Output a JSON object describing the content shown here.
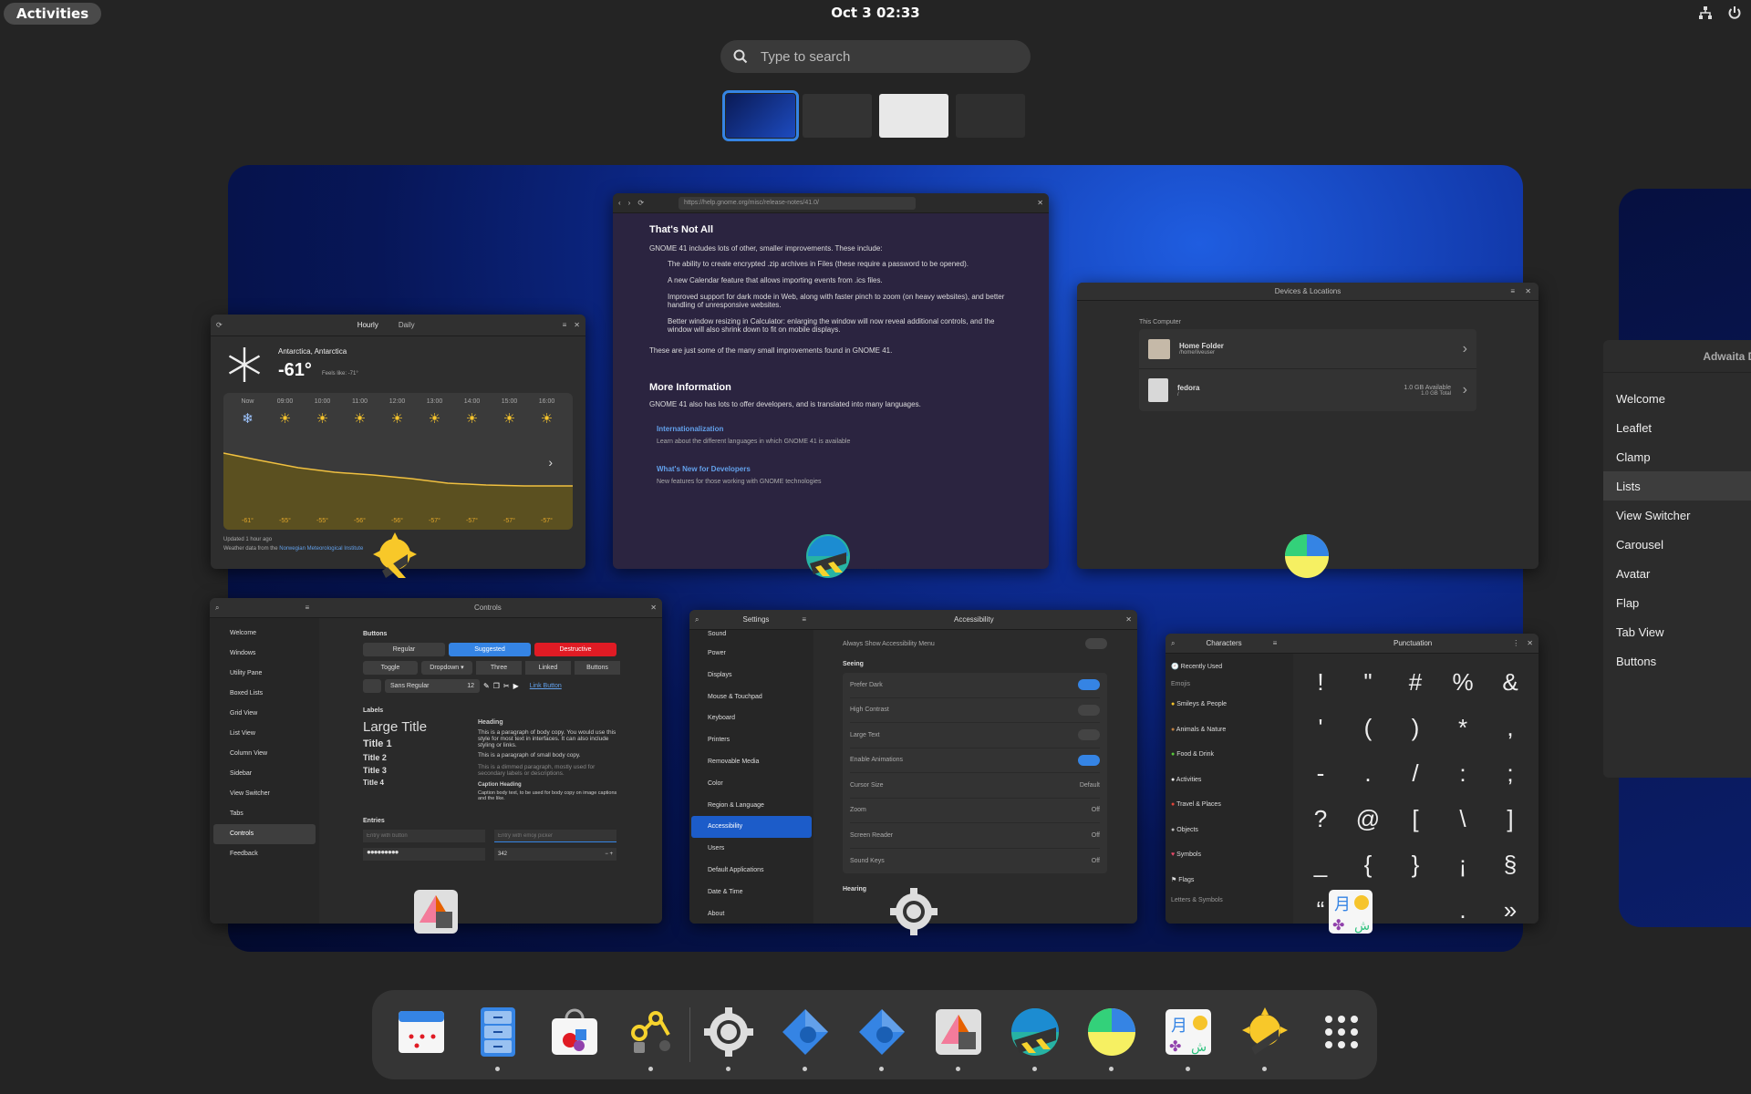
{
  "topbar": {
    "activities": "Activities",
    "clock": "Oct 3  02:33"
  },
  "search": {
    "placeholder": "Type to search"
  },
  "colors": {
    "accent": "#3584e4",
    "bg": "#242424",
    "dock": "#353535",
    "destructive": "#e01b24"
  },
  "browser": {
    "url": "https://help.gnome.org/misc/release-notes/41.0/",
    "h1": "That's Not All",
    "intro": "GNOME 41 includes lots of other, smaller improvements. These include:",
    "bullets": [
      "The ability to create encrypted .zip archives in Files (these require a password to be opened).",
      "A new Calendar feature that allows importing events from .ics files.",
      "Improved support for dark mode in Web, along with faster pinch to zoom (on heavy websites), and better handling of unresponsive websites.",
      "Better window resizing in Calculator: enlarging the window will now reveal additional controls, and the window will also shrink down to fit on mobile displays."
    ],
    "outro": "These are just some of the many small improvements found in GNOME 41.",
    "h2": "More Information",
    "more": "GNOME 41 also has lots to offer developers, and is translated into many languages.",
    "link1": "Internationalization",
    "link1_desc": "Learn about the different languages in which GNOME 41 is available",
    "link2": "What's New for Developers",
    "link2_desc": "New features for those working with GNOME technologies"
  },
  "weather": {
    "tab_hourly": "Hourly",
    "tab_daily": "Daily",
    "location": "Antarctica, Antarctica",
    "temp": "-61°",
    "feels": "Feels like: -71°",
    "hours": [
      "Now",
      "09:00",
      "10:00",
      "11:00",
      "12:00",
      "13:00",
      "14:00",
      "15:00",
      "16:00"
    ],
    "temps": [
      "-61°",
      "-55°",
      "-55°",
      "-56°",
      "-56°",
      "-57°",
      "-57°",
      "-57°",
      "-57°"
    ],
    "updated": "Updated 1 hour ago",
    "source_prefix": "Weather data from the ",
    "source_link": "Norwegian Meteorological Institute"
  },
  "files": {
    "title": "Devices & Locations",
    "section": "This Computer",
    "home": "Home Folder",
    "home_path": "/home/liveuser",
    "fedora": "fedora",
    "fedora_path": "/",
    "fedora_avail": "1.0 GB Available",
    "fedora_total": "1.0 GB Total"
  },
  "controls": {
    "title": "Controls",
    "sidebar": [
      "Welcome",
      "Windows",
      "Utility Pane",
      "Boxed Lists",
      "Grid View",
      "List View",
      "Column View",
      "Sidebar",
      "View Switcher",
      "Tabs",
      "Controls",
      "Feedback"
    ],
    "buttons_label": "Buttons",
    "regular": "Regular",
    "suggested": "Suggested",
    "destructive": "Destructive",
    "toggle": "Toggle",
    "dropdown": "Dropdown",
    "three": "Three",
    "linked": "Linked",
    "buttons": "Buttons",
    "font": "Sans Regular",
    "font_size": "12",
    "link_button": "Link Button",
    "labels": "Labels",
    "large_title": "Large Title",
    "title1": "Title 1",
    "title2": "Title 2",
    "title3": "Title 3",
    "title4": "Title 4",
    "heading": "Heading",
    "body1": "This is a paragraph of body copy. You would use this style for most text in interfaces. It can also include styling or links.",
    "body2": "This is a paragraph of small body copy.",
    "body3": "This is a dimmed paragraph, mostly used for secondary labels or descriptions.",
    "caption_heading": "Caption Heading",
    "caption": "Caption body text, to be used for body copy on image captions and the like.",
    "entries": "Entries",
    "entry1": "Entry with button",
    "entry2": "Entry with emoji picker",
    "spin": "342"
  },
  "settings": {
    "title": "Settings",
    "panel": "Accessibility",
    "sidebar": [
      "Sound",
      "Power",
      "Displays",
      "Mouse & Touchpad",
      "Keyboard",
      "Printers",
      "Removable Media",
      "Color",
      "Region & Language",
      "Accessibility",
      "Users",
      "Default Applications",
      "Date & Time",
      "About"
    ],
    "always_show": "Always Show Accessibility Menu",
    "seeing": "Seeing",
    "rows": [
      {
        "label": "Prefer Dark",
        "value": "on"
      },
      {
        "label": "High Contrast",
        "value": "off"
      },
      {
        "label": "Large Text",
        "value": "off"
      },
      {
        "label": "Enable Animations",
        "value": "on"
      },
      {
        "label": "Cursor Size",
        "value": "Default"
      },
      {
        "label": "Zoom",
        "value": "Off"
      },
      {
        "label": "Screen Reader",
        "value": "Off"
      },
      {
        "label": "Sound Keys",
        "value": "Off"
      }
    ],
    "hearing": "Hearing"
  },
  "characters": {
    "title": "Characters",
    "panel": "Punctuation",
    "recently": "Recently Used",
    "emojis": "Emojis",
    "categories": [
      "Smileys & People",
      "Animals & Nature",
      "Food & Drink",
      "Activities",
      "Travel & Places",
      "Objects",
      "Symbols",
      "Flags"
    ],
    "letters": "Letters & Symbols",
    "chars": [
      "!",
      "\"",
      "#",
      "%",
      "&",
      "'",
      "(",
      ")",
      "*",
      ",",
      "-",
      ".",
      "/",
      ":",
      ";",
      "?",
      "@",
      "[",
      "\\",
      "]",
      "_",
      "{",
      "}",
      "¡",
      "§",
      "“",
      "",
      "",
      ".",
      "»"
    ]
  },
  "adwaita": {
    "title": "Adwaita Demo",
    "items": [
      "Welcome",
      "Leaflet",
      "Clamp",
      "Lists",
      "View Switcher",
      "Carousel",
      "Avatar",
      "Flap",
      "Tab View",
      "Buttons"
    ],
    "selected": "Lists"
  },
  "dock": {
    "apps": [
      "calendar-icon",
      "files-icon",
      "software-icon",
      "builder-icon",
      "settings-icon",
      "boxes-icon",
      "boxes-icon-2",
      "text-editor-icon",
      "web-icon",
      "disk-usage-icon",
      "characters-icon",
      "weather-icon",
      "app-grid-icon"
    ]
  }
}
